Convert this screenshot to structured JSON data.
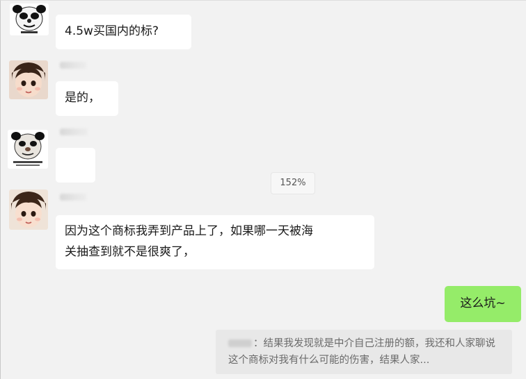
{
  "zoom": "152%",
  "messages": [
    {
      "sender": "other",
      "avatar_icon": "panda-meme-avatar-icon",
      "text": "4.5w买国内的标?"
    },
    {
      "sender": "other",
      "avatar_icon": "girl-avatar-icon",
      "text": "是的，"
    },
    {
      "sender": "other",
      "avatar_icon": "panda-meme-avatar-icon",
      "emoji": "laughing-tears-emoji-icon"
    },
    {
      "sender": "other",
      "avatar_icon": "girl-avatar-icon",
      "text": "因为这个商标我弄到产品上了，如果哪一天被海\n关抽查到就不是很爽了，"
    },
    {
      "sender": "me",
      "text": "这么坑~"
    }
  ],
  "quote": {
    "text": "：结果我发现就是中介自己注册的额，我还和人家聊说这个商标对我有什么可能的伤害，结果人家..."
  },
  "colors": {
    "background": "#f2f2f2",
    "bubble_other": "#ffffff",
    "bubble_me": "#95ec69",
    "quote_bg": "#e8e8e8"
  }
}
